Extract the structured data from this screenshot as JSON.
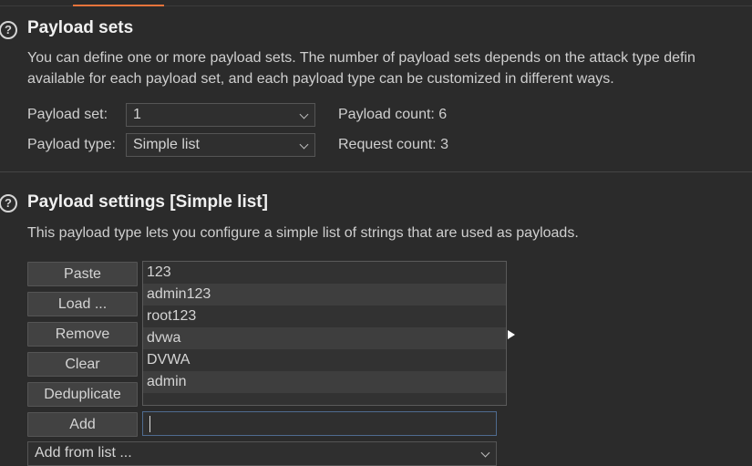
{
  "payload_sets": {
    "title": "Payload sets",
    "desc_line1": "You can define one or more payload sets. The number of payload sets depends on the attack type defin",
    "desc_line2": "available for each payload set, and each payload type can be customized in different ways.",
    "set_label": "Payload set:",
    "set_value": "1",
    "type_label": "Payload type:",
    "type_value": "Simple list",
    "payload_count": "Payload count: 6",
    "request_count": "Request count: 3"
  },
  "payload_settings": {
    "title": "Payload settings [Simple list]",
    "desc": "This payload type lets you configure a simple list of strings that are used as payloads.",
    "buttons": {
      "paste": "Paste",
      "load": "Load ...",
      "remove": "Remove",
      "clear": "Clear",
      "deduplicate": "Deduplicate",
      "add": "Add"
    },
    "items": [
      "123",
      "admin123",
      "root123",
      "dvwa",
      "DVWA",
      "admin"
    ],
    "add_input_value": "",
    "add_from_list": "Add from list ..."
  },
  "icons": {
    "help": "question-circle-icon",
    "dropdown": "chevron-down-icon"
  },
  "colors": {
    "background": "#2b2b2b",
    "accent": "#e8743b",
    "focus_border": "#4f6b8f"
  }
}
